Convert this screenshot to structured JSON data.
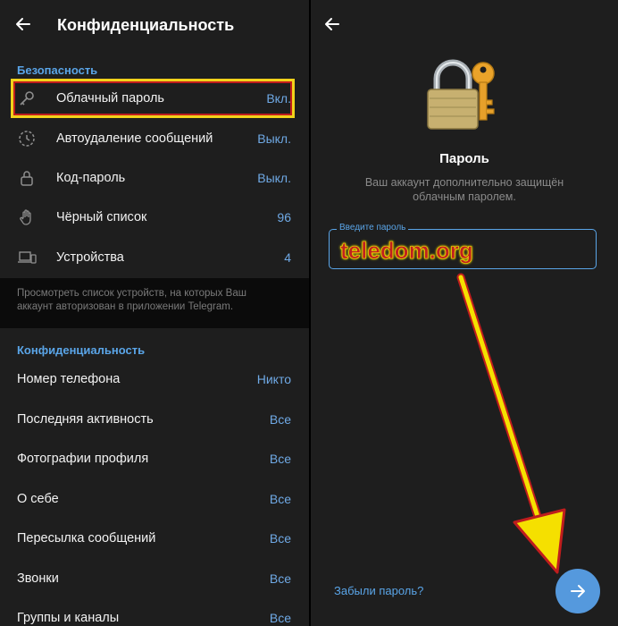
{
  "left": {
    "title": "Конфиденциальность",
    "security_header": "Безопасность",
    "security_items": [
      {
        "label": "Облачный пароль",
        "value": "Вкл.",
        "icon": "key-icon"
      },
      {
        "label": "Автоудаление сообщений",
        "value": "Выкл.",
        "icon": "timer-icon"
      },
      {
        "label": "Код-пароль",
        "value": "Выкл.",
        "icon": "lock-icon"
      },
      {
        "label": "Чёрный список",
        "value": "96",
        "icon": "hand-icon"
      },
      {
        "label": "Устройства",
        "value": "4",
        "icon": "devices-icon"
      }
    ],
    "devices_note": "Просмотреть список устройств, на которых Ваш аккаунт авторизован в приложении Telegram.",
    "privacy_header": "Конфиденциальность",
    "privacy_items": [
      {
        "label": "Номер телефона",
        "value": "Никто"
      },
      {
        "label": "Последняя активность",
        "value": "Все"
      },
      {
        "label": "Фотографии профиля",
        "value": "Все"
      },
      {
        "label": "О себе",
        "value": "Все"
      },
      {
        "label": "Пересылка сообщений",
        "value": "Все"
      },
      {
        "label": "Звонки",
        "value": "Все"
      },
      {
        "label": "Группы и каналы",
        "value": "Все"
      }
    ]
  },
  "right": {
    "title": "Пароль",
    "subtitle": "Ваш аккаунт дополнительно защищён облачным паролем.",
    "input_label": "Введите пароль",
    "watermark": "teledom.org",
    "forgot_link": "Забыли пароль?"
  },
  "colors": {
    "accent": "#5aa5e8",
    "highlight_border": "#f2d21a",
    "arrow": "#f5e000"
  }
}
